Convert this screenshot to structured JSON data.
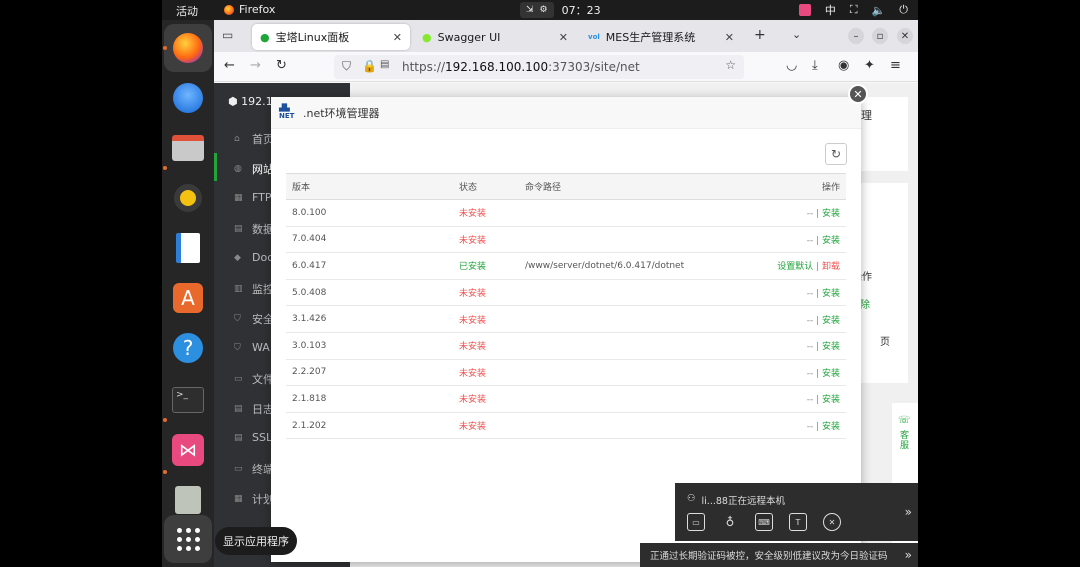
{
  "topbar": {
    "activities": "活动",
    "app_name": "Firefox",
    "clock": "07：23",
    "ime": "中"
  },
  "dock": {
    "show_apps_tooltip": "显示应用程序"
  },
  "browser": {
    "tabs": [
      {
        "label": "宝塔Linux面板",
        "active": true
      },
      {
        "label": "Swagger UI",
        "active": false
      },
      {
        "label": "MES生产管理系统",
        "active": false
      }
    ],
    "url_prefix": "https://",
    "url_host": "192.168.100.100",
    "url_path": ":37303/site/net"
  },
  "panel": {
    "host": "192.1",
    "nav": [
      "首页",
      "网站",
      "FTP",
      "数据",
      "Doc",
      "监控",
      "安全",
      "WA",
      "文件",
      "日志",
      "SSL",
      "终端",
      "计划"
    ],
    "bg_right_labels": [
      "理",
      "操作",
      "删除",
      "页"
    ]
  },
  "modal": {
    "title": ".net环境管理器",
    "logo_text": "NET",
    "columns": [
      "版本",
      "状态",
      "命令路径",
      "操作"
    ],
    "rows": [
      {
        "version": "8.0.100",
        "status": "未安装",
        "path": "",
        "op1": "--",
        "op2": "安装"
      },
      {
        "version": "7.0.404",
        "status": "未安装",
        "path": "",
        "op1": "--",
        "op2": "安装"
      },
      {
        "version": "6.0.417",
        "status": "已安装",
        "path": "/www/server/dotnet/6.0.417/dotnet",
        "op1": "设置默认",
        "op2": "卸载"
      },
      {
        "version": "5.0.408",
        "status": "未安装",
        "path": "",
        "op1": "--",
        "op2": "安装"
      },
      {
        "version": "3.1.426",
        "status": "未安装",
        "path": "",
        "op1": "--",
        "op2": "安装"
      },
      {
        "version": "3.0.103",
        "status": "未安装",
        "path": "",
        "op1": "--",
        "op2": "安装"
      },
      {
        "version": "2.2.207",
        "status": "未安装",
        "path": "",
        "op1": "--",
        "op2": "安装"
      },
      {
        "version": "2.1.818",
        "status": "未安装",
        "path": "",
        "op1": "--",
        "op2": "安装"
      },
      {
        "version": "2.1.202",
        "status": "未安装",
        "path": "",
        "op1": "--",
        "op2": "安装"
      }
    ]
  },
  "remote": {
    "title": "li...88正在远程本机",
    "notice": "正通过长期验证码被控，安全级别低建议改为今日验证码"
  },
  "support_label": "客服"
}
